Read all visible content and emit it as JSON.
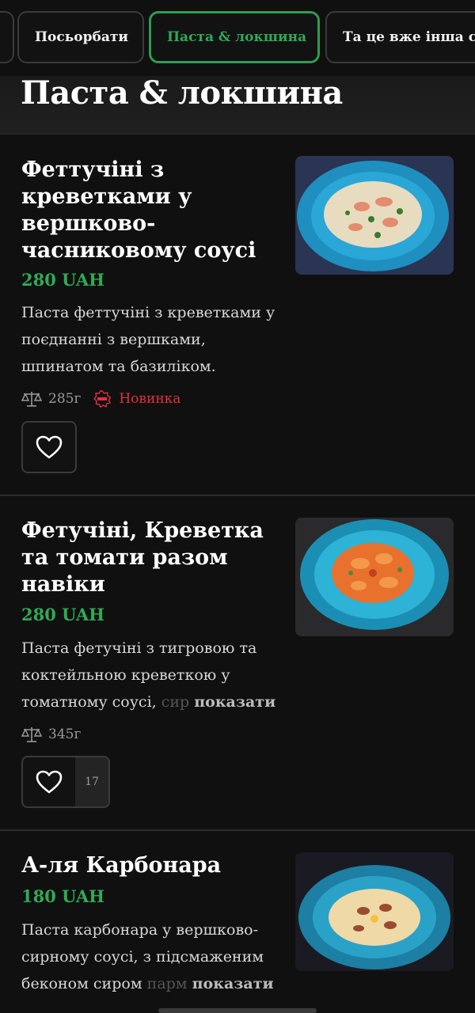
{
  "tabs": {
    "items": [
      {
        "label": "Посьорбати"
      },
      {
        "label": "Паста & локшина",
        "active": true
      },
      {
        "label": "Та це вже інша ст"
      }
    ]
  },
  "section": {
    "title": "Паста & локшина"
  },
  "items": [
    {
      "name": "Феттучіні з креветками у вершково-часниковому соусі",
      "price": "280 UAH",
      "description": "Паста феттучіні з креветками у поєднанні з вершками, шпинатом та базиліком.",
      "weight": "285г",
      "badge": "Новинка",
      "like_count": ""
    },
    {
      "name": "Фетучіні, Креветка та томати разом навіки",
      "price": "280 UAH",
      "description": "Паста фетучіні з тигровою та коктейльною креветкою у томатному соусі,",
      "description_fade": "сир",
      "more_label": "показати",
      "weight": "345г",
      "like_count": "17"
    },
    {
      "name": "А-ля Карбонара",
      "price": "180 UAH",
      "description": "Паста карбонара у вершково-сирному соусі, з підсмаженим беконом сиром",
      "description_fade": "парм",
      "more_label": "показати"
    }
  ],
  "colors": {
    "accent": "#2faa55",
    "new_badge": "#e0303a",
    "background": "#101010"
  },
  "icons": [
    "weight-scale-icon",
    "new-badge-icon",
    "heart-icon"
  ]
}
